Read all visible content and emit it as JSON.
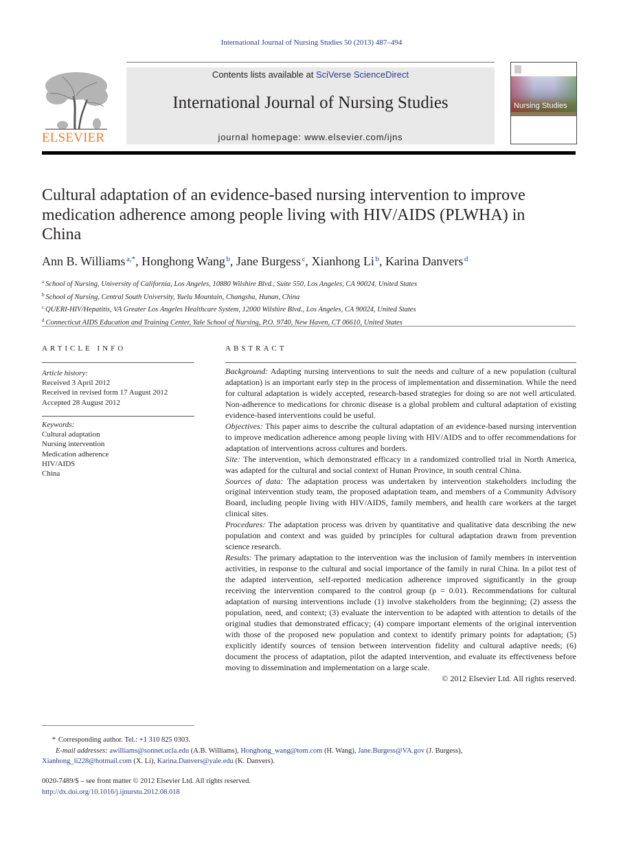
{
  "running_head": "International Journal of Nursing Studies 50 (2013) 487–494",
  "masthead": {
    "publisher_logo_word": "ELSEVIER",
    "contents_prefix": "Contents lists available at ",
    "contents_link": "SciVerse ScienceDirect",
    "journal_title": "International Journal of Nursing Studies",
    "homepage": "journal homepage: www.elsevier.com/ijns",
    "cover_title": "Nursing Studies"
  },
  "article": {
    "title": "Cultural adaptation of an evidence-based nursing intervention to improve medication adherence among people living with HIV/AIDS (PLWHA) in China",
    "authors": [
      {
        "name": "Ann B. Williams",
        "sup": "a,*"
      },
      {
        "name": "Honghong Wang",
        "sup": "b"
      },
      {
        "name": "Jane Burgess",
        "sup": "c"
      },
      {
        "name": "Xianhong Li",
        "sup": "b"
      },
      {
        "name": "Karina Danvers",
        "sup": "d"
      }
    ],
    "affiliations": [
      {
        "key": "a",
        "text": "School of Nursing, University of California, Los Angeles, 10880 Wilshire Blvd., Suite 550, Los Angeles, CA 90024, United States"
      },
      {
        "key": "b",
        "text": "School of Nursing, Central South University, Yuelu Mountain, Changsha, Hunan, China"
      },
      {
        "key": "c",
        "text": "QUERI-HIV/Hepatitis, VA Greater Los Angeles Healthcare System, 12000 Wilshire Blvd., Los Angeles, CA 90024, United States"
      },
      {
        "key": "d",
        "text": "Connecticut AIDS Education and Training Center, Yale School of Nursing, P.O. 9740, New Haven, CT 06610, United States"
      }
    ]
  },
  "article_info": {
    "heading": "ARTICLE INFO",
    "history_label": "Article history:",
    "history": [
      "Received 3 April 2012",
      "Received in revised form 17 August 2012",
      "Accepted 28 August 2012"
    ],
    "keywords_label": "Keywords:",
    "keywords": [
      "Cultural adaptation",
      "Nursing intervention",
      "Medication adherence",
      "HIV/AIDS",
      "China"
    ]
  },
  "abstract": {
    "heading": "ABSTRACT",
    "sections": [
      {
        "label": "Background:",
        "text": " Adapting nursing interventions to suit the needs and culture of a new population (cultural adaptation) is an important early step in the process of implementation and dissemination. While the need for cultural adaptation is widely accepted, research-based strategies for doing so are not well articulated. Non-adherence to medications for chronic disease is a global problem and cultural adaptation of existing evidence-based interventions could be useful."
      },
      {
        "label": "Objectives:",
        "text": " This paper aims to describe the cultural adaptation of an evidence-based nursing intervention to improve medication adherence among people living with HIV/AIDS and to offer recommendations for adaptation of interventions across cultures and borders."
      },
      {
        "label": "Site:",
        "text": " The intervention, which demonstrated efficacy in a randomized controlled trial in North America, was adapted for the cultural and social context of Hunan Province, in south central China."
      },
      {
        "label": "Sources of data:",
        "text": " The adaptation process was undertaken by intervention stakeholders including the original intervention study team, the proposed adaptation team, and members of a Community Advisory Board, including people living with HIV/AIDS, family members, and health care workers at the target clinical sites."
      },
      {
        "label": "Procedures:",
        "text": " The adaptation process was driven by quantitative and qualitative data describing the new population and context and was guided by principles for cultural adaptation drawn from prevention science research."
      },
      {
        "label": "Results:",
        "text": " The primary adaptation to the intervention was the inclusion of family members in intervention activities, in response to the cultural and social importance of the family in rural China. In a pilot test of the adapted intervention, self-reported medication adherence improved significantly in the group receiving the intervention compared to the control group (p = 0.01). Recommendations for cultural adaptation of nursing interventions include (1) involve stakeholders from the beginning; (2) assess the population, need, and context; (3) evaluate the intervention to be adapted with attention to details of the original studies that demonstrated efficacy; (4) compare important elements of the original intervention with those of the proposed new population and context to identify primary points for adaptation; (5) explicitly identify sources of tension between intervention fidelity and cultural adaptive needs; (6) document the process of adaptation, pilot the adapted intervention, and evaluate its effectiveness before moving to dissemination and implementation on a large scale."
      }
    ],
    "copyright": "© 2012 Elsevier Ltd. All rights reserved."
  },
  "footnotes": {
    "star": "*",
    "corresponding": "Corresponding author. Tel.: +1 310 825 0303.",
    "email_label": "E-mail addresses:",
    "emails": [
      {
        "address": "awilliams@sonnet.ucla.edu",
        "who": " (A.B. Williams), "
      },
      {
        "address": "Honghong_wang@tom.com",
        "who": " (H. Wang), "
      },
      {
        "address": "Jane.Burgess@VA.gov",
        "who": " (J. Burgess), "
      },
      {
        "address": "Xianhong_li228@hotmail.com",
        "who": " (X. Li), "
      },
      {
        "address": "Karina.Danvers@yale.edu",
        "who": " (K. Danvers)."
      }
    ]
  },
  "footer": {
    "issn": "0020-7489/$ – see front matter © 2012 Elsevier Ltd. All rights reserved.",
    "doi": "http://dx.doi.org/10.1016/j.ijnurstu.2012.08.018"
  },
  "colors": {
    "link": "#2a3a8f",
    "elsevier_orange": "#f47b20",
    "masthead_gray": "#e9e9ea"
  }
}
